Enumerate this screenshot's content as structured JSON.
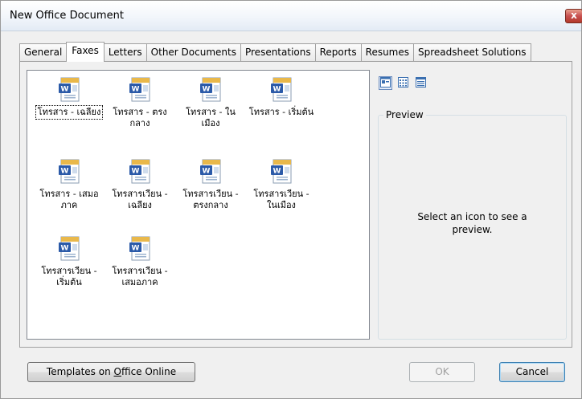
{
  "window": {
    "title": "New Office Document",
    "close_label": "x"
  },
  "tabs": [
    {
      "label": "General"
    },
    {
      "label": "Faxes"
    },
    {
      "label": "Letters"
    },
    {
      "label": "Other Documents"
    },
    {
      "label": "Presentations"
    },
    {
      "label": "Reports"
    },
    {
      "label": "Resumes"
    },
    {
      "label": "Spreadsheet Solutions"
    }
  ],
  "active_tab": "Faxes",
  "templates": [
    {
      "label": "โทรสาร - เฉลียง",
      "icon": "word-document-icon"
    },
    {
      "label": "โทรสาร - ตรงกลาง",
      "icon": "word-document-icon"
    },
    {
      "label": "โทรสาร - ในเมือง",
      "icon": "word-document-icon"
    },
    {
      "label": "โทรสาร - เริ่มต้น",
      "icon": "word-document-icon"
    },
    {
      "label": "โทรสาร - เสมอภาค",
      "icon": "word-document-icon"
    },
    {
      "label": "โทรสารเวียน - เฉลียง",
      "icon": "word-document-icon"
    },
    {
      "label": "โทรสารเวียน - ตรงกลาง",
      "icon": "word-document-icon"
    },
    {
      "label": "โทรสารเวียน - ในเมือง",
      "icon": "word-document-icon"
    },
    {
      "label": "โทรสารเวียน - เริ่มต้น",
      "icon": "word-document-icon"
    },
    {
      "label": "โทรสารเวียน - เสมอภาค",
      "icon": "word-document-icon"
    }
  ],
  "view_modes": [
    "large-icons-view-icon",
    "list-view-icon",
    "details-view-icon"
  ],
  "preview": {
    "legend": "Preview",
    "message": "Select an icon to see a preview."
  },
  "buttons": {
    "templates_online_prefix": "Templates on ",
    "templates_online_accel": "O",
    "templates_online_suffix": "ffice Online",
    "ok": "OK",
    "cancel": "Cancel"
  },
  "colors": {
    "accent": "#3c7fb1",
    "close": "#c75050"
  }
}
